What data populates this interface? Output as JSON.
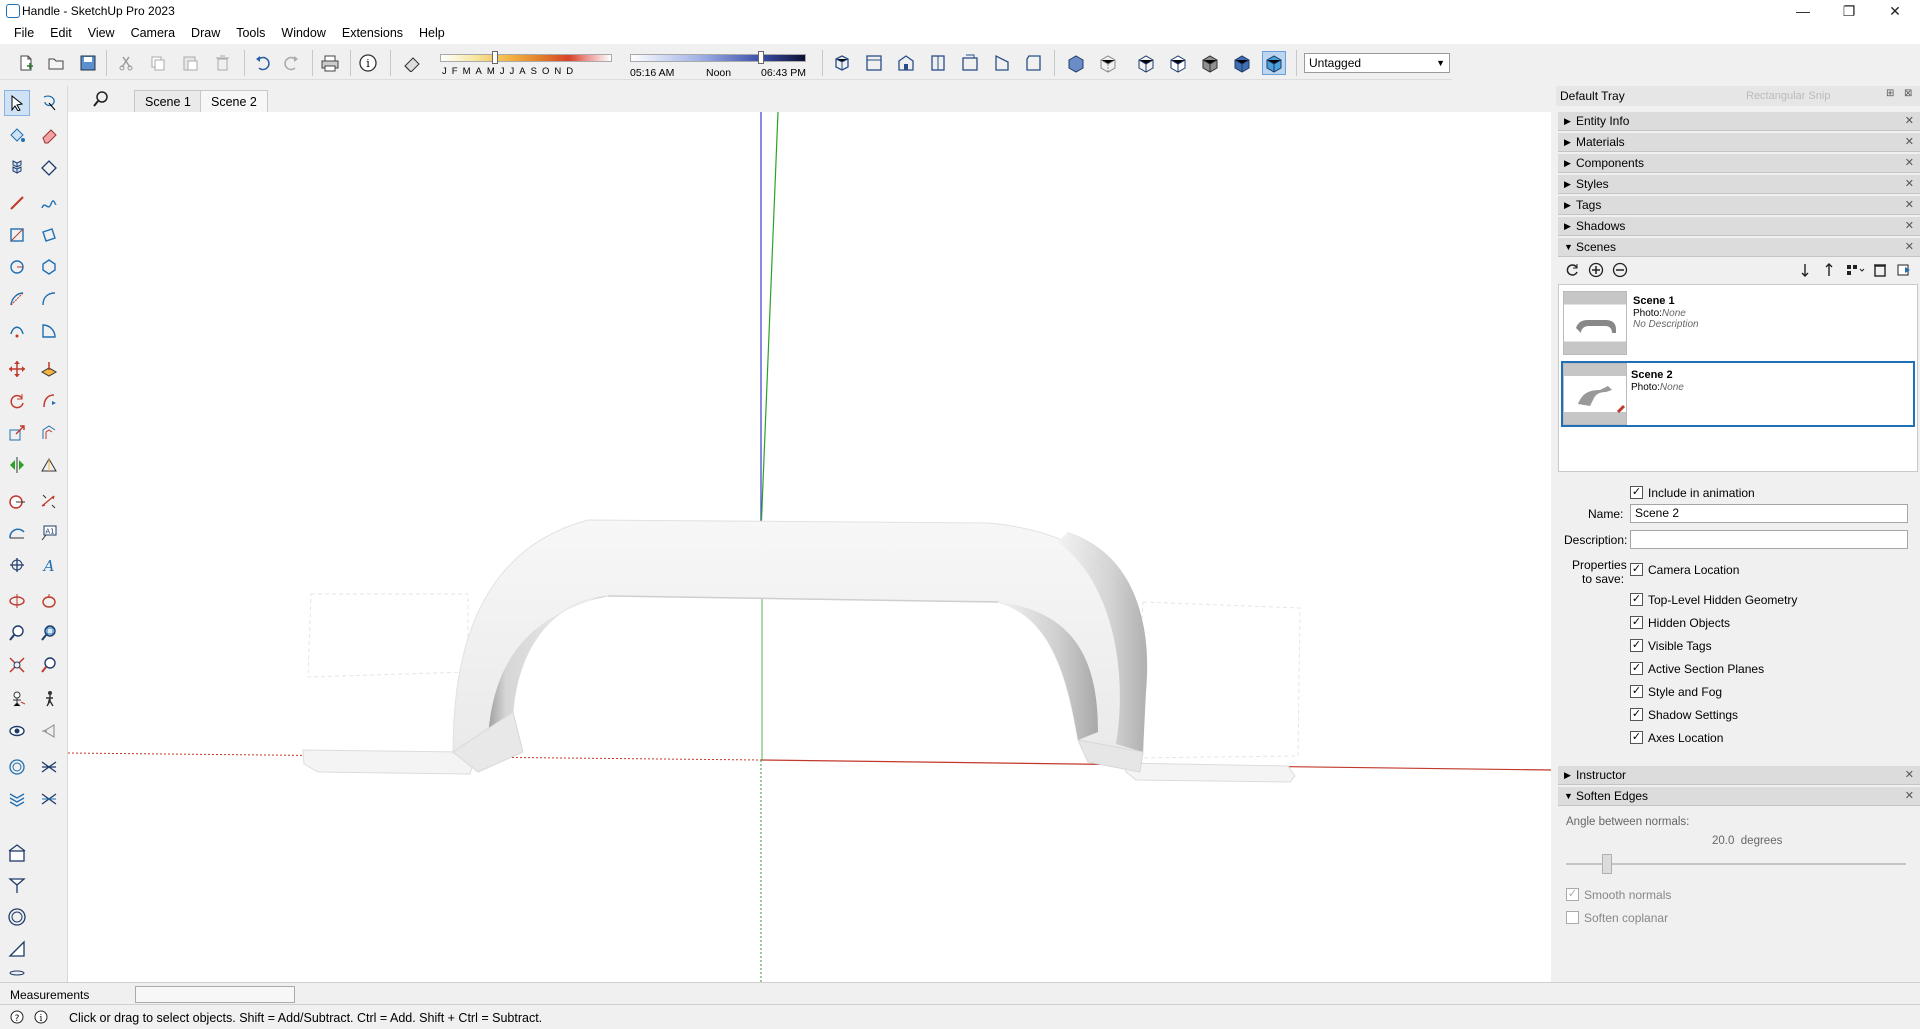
{
  "window": {
    "title": "Handle - SketchUp Pro 2023",
    "minimize": "—",
    "restore": "❐",
    "close": "✕"
  },
  "menu": [
    "File",
    "Edit",
    "View",
    "Camera",
    "Draw",
    "Tools",
    "Window",
    "Extensions",
    "Help"
  ],
  "shadows": {
    "months": [
      "J",
      "F",
      "M",
      "A",
      "M",
      "J",
      "J",
      "A",
      "S",
      "O",
      "N",
      "D"
    ],
    "sunrise": "05:16 AM",
    "noon": "Noon",
    "sunset": "06:43 PM"
  },
  "tag_dropdown": {
    "selected": "Untagged"
  },
  "scene_tabs": [
    "Scene 1",
    "Scene 2"
  ],
  "active_scene_tab": 1,
  "tray": {
    "title": "Default Tray",
    "faded_tooltip": "Rectangular Snip",
    "panels": [
      "Entity Info",
      "Materials",
      "Components",
      "Styles",
      "Tags",
      "Shadows"
    ],
    "scenes_panel": "Scenes",
    "scenes": [
      {
        "name": "Scene 1",
        "photo_label": "Photo:",
        "photo": "None",
        "description": "No Description"
      },
      {
        "name": "Scene 2",
        "photo_label": "Photo:",
        "photo": "None",
        "description": ""
      }
    ],
    "include_animation": "Include in animation",
    "name_label": "Name:",
    "name_value": "Scene 2",
    "description_label": "Description:",
    "description_value": "",
    "properties_label_1": "Properties",
    "properties_label_2": "to save:",
    "properties": [
      "Camera Location",
      "Top-Level Hidden Geometry",
      "Hidden Objects",
      "Visible Tags",
      "Active Section Planes",
      "Style and Fog",
      "Shadow Settings",
      "Axes Location"
    ],
    "instructor": "Instructor",
    "soften_edges": "Soften Edges",
    "angle_label": "Angle between normals:",
    "angle_value": "20.0",
    "angle_unit": "degrees",
    "angle_slider_fraction": 0.12,
    "smooth_normals": "Smooth normals",
    "soften_coplanar": "Soften coplanar"
  },
  "measurements": {
    "label": "Measurements",
    "value": ""
  },
  "status": {
    "hint": "Click or drag to select objects. Shift = Add/Subtract. Ctrl = Add. Shift + Ctrl = Subtract."
  },
  "colors": {
    "accent": "#1e70b8",
    "axis_red": "#c0392b",
    "axis_green": "#27a327",
    "axis_blue": "#3a3ad6"
  }
}
